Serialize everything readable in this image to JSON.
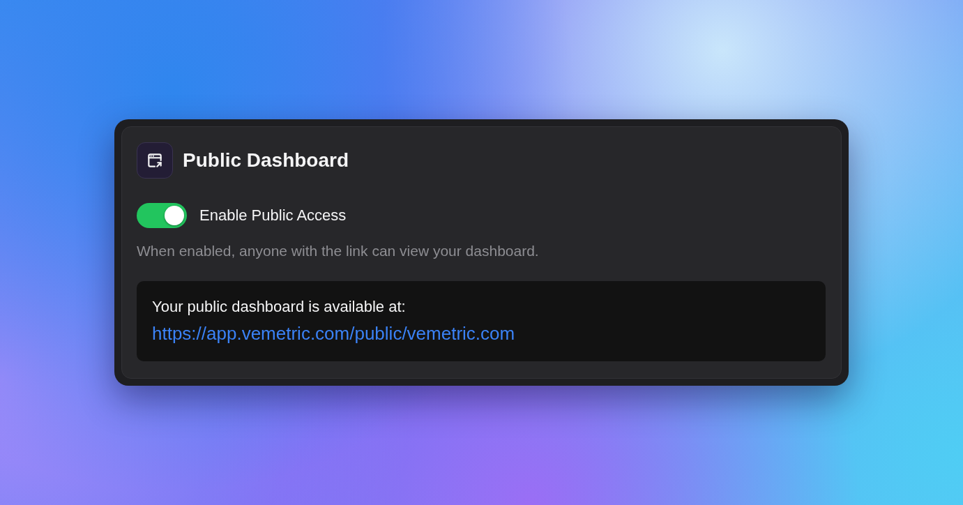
{
  "card": {
    "title": "Public Dashboard"
  },
  "toggle": {
    "label": "Enable Public Access",
    "on": true
  },
  "description": "When enabled, anyone with the link can view your dashboard.",
  "share_box": {
    "text": "Your public dashboard is available at:",
    "link": "https://app.vemetric.com/public/vemetric.com"
  }
}
